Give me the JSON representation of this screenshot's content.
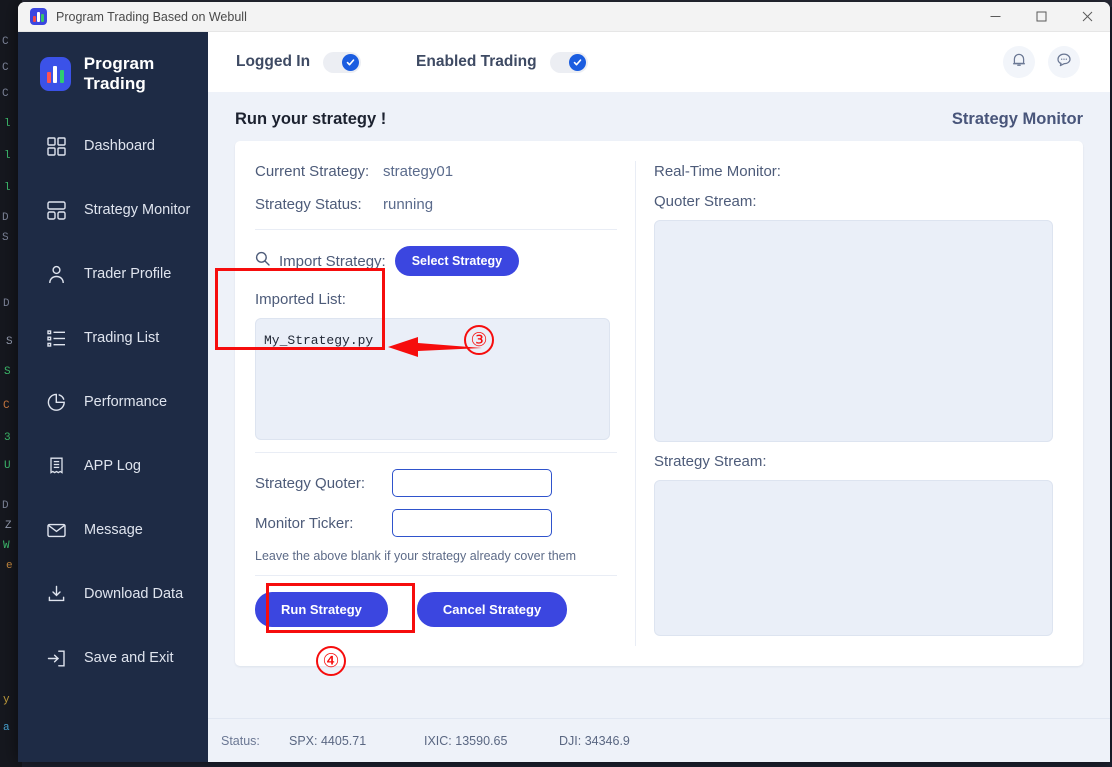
{
  "window": {
    "title": "Program Trading Based on Webull",
    "controls": {
      "minimize": "minimize-icon",
      "maximize": "maximize-icon",
      "close": "close-icon"
    }
  },
  "sidebar": {
    "brand": "Program Trading",
    "items": [
      {
        "label": "Dashboard",
        "icon": "grid-icon",
        "active": false
      },
      {
        "label": "Strategy Monitor",
        "icon": "layout-icon",
        "active": true
      },
      {
        "label": "Trader Profile",
        "icon": "user-icon",
        "active": false
      },
      {
        "label": "Trading List",
        "icon": "list-icon",
        "active": false
      },
      {
        "label": "Performance",
        "icon": "pie-chart-icon",
        "active": false
      },
      {
        "label": "APP Log",
        "icon": "receipt-icon",
        "active": false
      },
      {
        "label": "Message",
        "icon": "mail-icon",
        "active": false
      },
      {
        "label": "Download Data",
        "icon": "download-icon",
        "active": false
      },
      {
        "label": "Save and Exit",
        "icon": "logout-icon",
        "active": false
      }
    ]
  },
  "topbar": {
    "logged_in_label": "Logged In",
    "logged_in_state": "on",
    "enabled_trading_label": "Enabled Trading",
    "enabled_trading_state": "on",
    "notification_icon": "bell-icon",
    "chat_icon": "chat-bubble-icon"
  },
  "main": {
    "title": "Run your strategy !",
    "subtitle": "Strategy Monitor",
    "left": {
      "current_strategy_label": "Current Strategy:",
      "current_strategy_value": "strategy01",
      "strategy_status_label": "Strategy Status:",
      "strategy_status_value": "running",
      "import_icon": "search-icon",
      "import_label": "Import Strategy:",
      "select_strategy_button": "Select Strategy",
      "imported_list_label": "Imported List:",
      "imported_files": [
        "My_Strategy.py"
      ],
      "strategy_quoter_label": "Strategy Quoter:",
      "strategy_quoter_value": "",
      "monitor_ticker_label": "Monitor Ticker:",
      "monitor_ticker_value": "",
      "hint": "Leave the above blank if your strategy already cover them",
      "run_button": "Run Strategy",
      "cancel_button": "Cancel Strategy"
    },
    "right": {
      "realtime_monitor_label": "Real-Time Monitor:",
      "quoter_stream_label": "Quoter Stream:",
      "quoter_stream_value": "",
      "strategy_stream_label": "Strategy Stream:",
      "strategy_stream_value": ""
    }
  },
  "annotations": [
    {
      "number": "③",
      "target": "imported-list"
    },
    {
      "number": "④",
      "target": "run-strategy-button"
    }
  ],
  "statusbar": {
    "label": "Status:",
    "items": [
      "SPX: 4405.71",
      "IXIC: 13590.65",
      "DJI: 34346.9"
    ]
  },
  "colors": {
    "accent_blue": "#3b46e0",
    "sidebar_bg": "#1e2b45",
    "content_bg": "#eef2f9",
    "annotation_red": "#f60d0d"
  }
}
